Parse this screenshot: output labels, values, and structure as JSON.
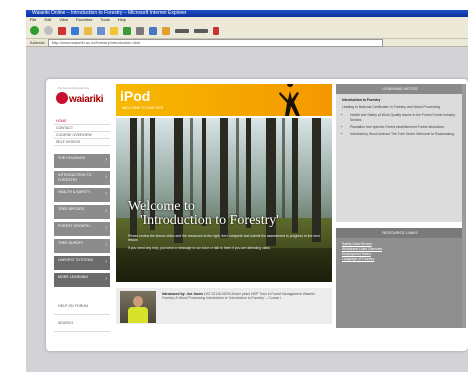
{
  "browser": {
    "title": "Waiariki Online – Introduction to Forestry – Microsoft Internet Explorer",
    "menu": [
      "File",
      "Edit",
      "View",
      "Favorites",
      "Tools",
      "Help"
    ],
    "address_label": "Address",
    "url": "http://www.waiariki.ac.nz/forestry/introduction.html"
  },
  "site": {
    "logo_tagline": "the best online learning",
    "logo_name": "waiariki",
    "small_nav": [
      "HOME",
      "CONTACT",
      "COURSE OVERVIEW",
      "SELF ASSESS"
    ],
    "topics": [
      "THE HOLDINGS",
      "INTRODUCTION TO FORESTRY",
      "HEALTH & SAFETY",
      "TREE SPECIES",
      "FOREST GROWTH",
      "TREE SURVEY",
      "HARVEST SYSTEMS",
      "MORE LEARNING"
    ],
    "help_items": [
      "HELP ON FORUM",
      "SEARCH"
    ],
    "banner": {
      "brand": "iPod",
      "sub": "WELCOME TO OUR SITE"
    },
    "hero": {
      "heading_1": "Welcome to",
      "heading_2": "'Introduction to Forestry'",
      "para_1": "Please review the lesson video and the resources to the right, then complete and submit the assessment to progress to the next lesson.",
      "para_2": "If you need any help, just send a message to our tutor or talk to them if you are attending class."
    },
    "intro": {
      "lead": "Introduced by: Joe Jones",
      "text": "DAT 02126 ADPA Zealer years NDP Tutor in Forest Management Waiariki Forestry & Wood Processing Introduction to 'Introduction to Forestry' – Course I"
    },
    "learning_outcomes": {
      "header": "LEARNING NOTES",
      "title": "Introduction to Forestry",
      "para": "Leading to National Certificates in Forestry and Wood Processing",
      "bullets": [
        "Health and Safety at Work Quality Issues in the Forest Forest Industry Sectors",
        "Plantation tree species Forest establishment Forest silviculture",
        "Introductory Wood science The Tree Sector Welcome to Roadmaking"
      ]
    },
    "resource_links": {
      "header": "RESOURCE LINKS",
      "links": [
        "Safety Data Review",
        "Worksheet Links Overview",
        "Employment Rates",
        "Language of Forestry"
      ]
    }
  }
}
